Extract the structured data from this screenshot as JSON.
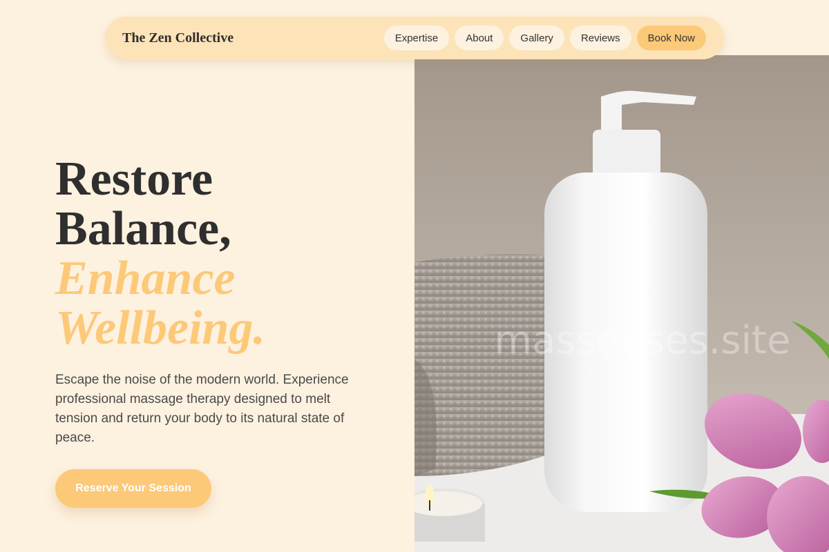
{
  "nav": {
    "brand": "The Zen Collective",
    "links": [
      "Expertise",
      "About",
      "Gallery",
      "Reviews"
    ],
    "book_label": "Book Now"
  },
  "hero": {
    "title_line1": "Restore",
    "title_line2": "Balance,",
    "title_accent1": "Enhance",
    "title_accent2": "Wellbeing.",
    "description": "Escape the noise of the modern world. Experience professional massage therapy designed to melt tension and return your body to its natural state of peace.",
    "cta_label": "Reserve Your Session",
    "image_watermark": "masseuses.site"
  },
  "colors": {
    "background": "#fdf1e0",
    "nav_background": "#fde3b8",
    "accent": "#fcc978",
    "text": "#2f2f2f"
  }
}
